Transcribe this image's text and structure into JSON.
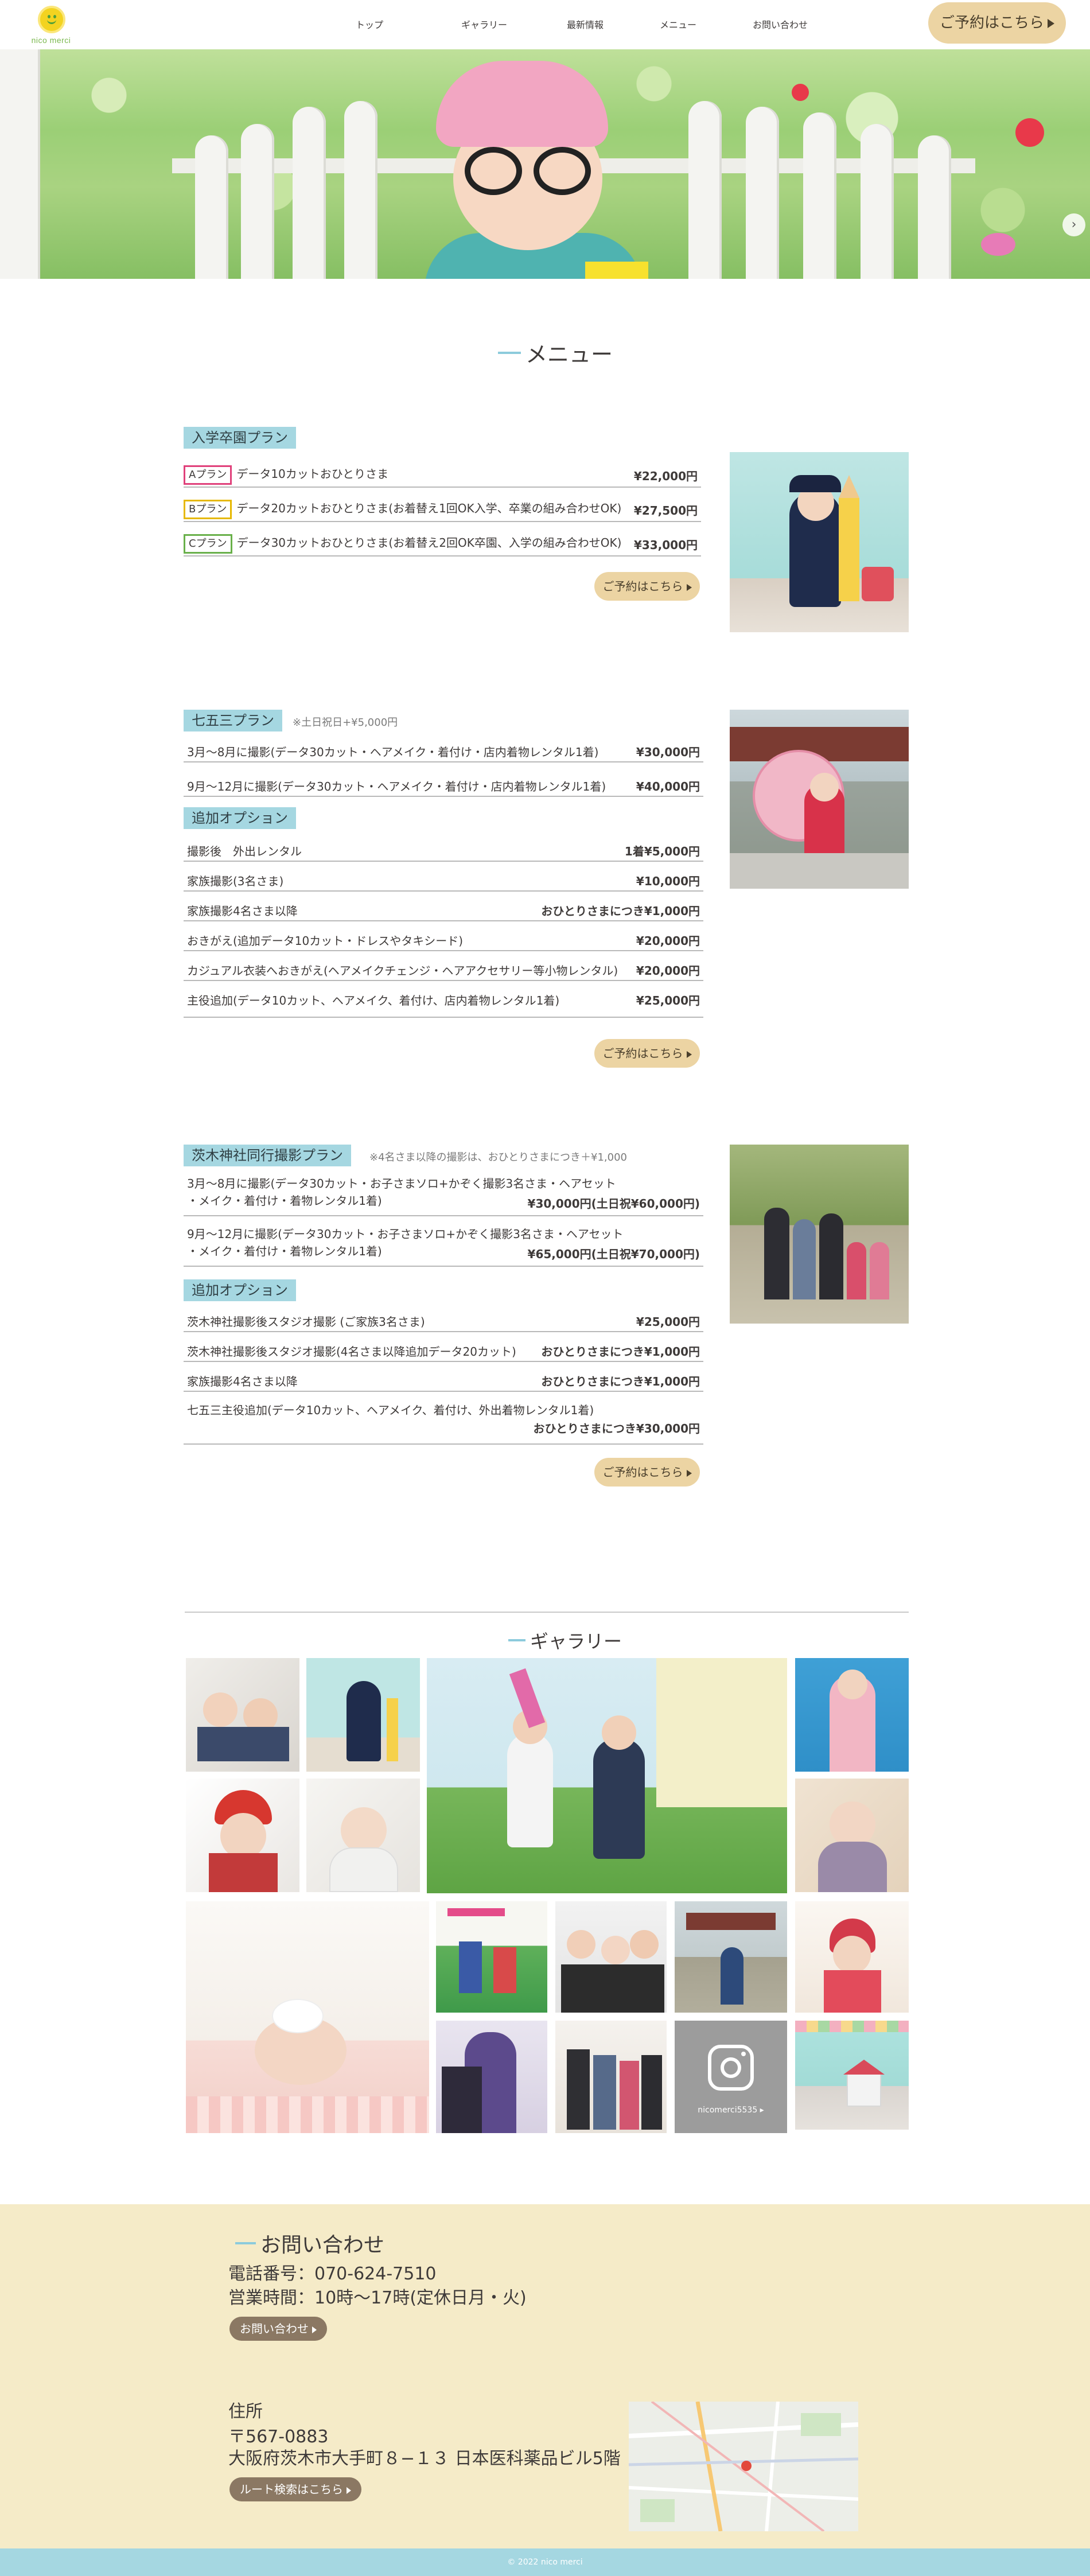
{
  "header": {
    "logo_text": "nico merci",
    "nav": [
      "トップ",
      "ギャラリー",
      "最新情報",
      "メニュー",
      "お問い合わせ"
    ],
    "reserve_button": "ご予約はこちら"
  },
  "menu": {
    "title": "メニュー",
    "plan1": {
      "tag": "入学卒園プラン",
      "rows": [
        {
          "badge": "Aプラン",
          "badge_color": "#e0407a",
          "label": "データ10カットおひとりさま",
          "price": "¥22,000円"
        },
        {
          "badge": "Bプラン",
          "badge_color": "#e6b800",
          "label": "データ20カットおひとりさま(お着替え1回OK入学、卒業の組み合わせOK)",
          "price": "¥27,500円"
        },
        {
          "badge": "Cプラン",
          "badge_color": "#69b04a",
          "label": "データ30カットおひとりさま(お着替え2回OK卒園、入学の組み合わせOK)",
          "price": "¥33,000円"
        }
      ],
      "button": "ご予約はこちら"
    },
    "plan2": {
      "tag": "七五三プラン",
      "note": "※土日祝日+¥5,000円",
      "rows": [
        {
          "label": "3月〜8月に撮影(データ30カット・ヘアメイク・着付け・店内着物レンタル1着)",
          "price": "¥30,000円"
        },
        {
          "label": "9月〜12月に撮影(データ30カット・ヘアメイク・着付け・店内着物レンタル1着)",
          "price": "¥40,000円"
        }
      ],
      "option_tag": "追加オプション",
      "options": [
        {
          "label": "撮影後　外出レンタル",
          "price": "1着¥5,000円"
        },
        {
          "label": "家族撮影(3名さま)",
          "price": "¥10,000円"
        },
        {
          "label": "家族撮影4名さま以降",
          "price": "おひとりさまにつき¥1,000円"
        },
        {
          "label": "おきがえ(追加データ10カット・ドレスやタキシード)",
          "price": "¥20,000円"
        },
        {
          "label": "カジュアル衣装へおきがえ(ヘアメイクチェンジ・ヘアアクセサリー等小物レンタル)",
          "price": "¥20,000円"
        },
        {
          "label": "主役追加(データ10カット、ヘアメイク、着付け、店内着物レンタル1着)",
          "price": "¥25,000円"
        }
      ],
      "button": "ご予約はこちら"
    },
    "plan3": {
      "tag": "茨木神社同行撮影プラン",
      "note": "※4名さま以降の撮影は、おひとりさまにつき＋¥1,000",
      "rows": [
        {
          "label1": "3月〜8月に撮影(データ30カット・お子さまソロ+かぞく撮影3名さま・ヘアセット",
          "label2": "・メイク・着付け・着物レンタル1着)",
          "price": "¥30,000円(土日祝¥60,000円)"
        },
        {
          "label1": "9月〜12月に撮影(データ30カット・お子さまソロ+かぞく撮影3名さま・ヘアセット",
          "label2": "・メイク・着付け・着物レンタル1着)",
          "price": "¥65,000円(土日祝¥70,000円)"
        }
      ],
      "option_tag": "追加オプション",
      "options": [
        {
          "label": "茨木神社撮影後スタジオ撮影 (ご家族3名さま)",
          "price": "¥25,000円"
        },
        {
          "label": "茨木神社撮影後スタジオ撮影(4名さま以降追加データ20カット)",
          "price": "おひとりさまにつき¥1,000円"
        },
        {
          "label": "家族撮影4名さま以降",
          "price": "おひとりさまにつき¥1,000円"
        }
      ],
      "last_option": {
        "label": "七五三主役追加(データ10カット、ヘアメイク、着付け、外出着物レンタル1着)",
        "price": "おひとりさまにつき¥30,000円"
      },
      "button": "ご予約はこちら"
    }
  },
  "gallery": {
    "title": "ギャラリー",
    "instagram_label": "nicomerci5535 ▸"
  },
  "contact": {
    "title": "お問い合わせ",
    "phone": "電話番号：070-624-7510",
    "hours": "営業時間：10時〜17時(定休日月・火)",
    "contact_button": "お問い合わせ",
    "address_label": "住所",
    "postal": "〒567-0883",
    "address": "大阪府茨木市大手町８−１３ 日本医科薬品ビル5階",
    "route_button": "ルート検索はこちら"
  },
  "footer": {
    "copyright": "© 2022 nico merci"
  }
}
